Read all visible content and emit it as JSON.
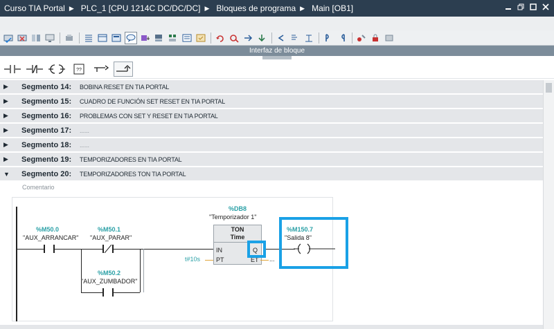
{
  "titlebar": {
    "crumbs": [
      "Curso TIA Portal",
      "PLC_1 [CPU 1214C DC/DC/DC]",
      "Bloques de programa",
      "Main [OB1]"
    ],
    "window_buttons": [
      "minimize",
      "restore",
      "maximize",
      "close"
    ]
  },
  "toolbar": {
    "icons": [
      "insert-network-icon",
      "delete-network-icon",
      "compare-icon",
      "monitor-icon",
      "settings-icon",
      "list-icon",
      "display-icon",
      "note-icon",
      "comment-icon",
      "absolute-icon",
      "symbolic-icon",
      "bookmark-icon",
      "favorites-icon",
      "network-insert-icon",
      "undo-icon",
      "redo-icon",
      "go-to-icon",
      "back-icon",
      "forward-icon",
      "monitor-on-icon",
      "monitor-off-icon",
      "download-icon",
      "online-icon"
    ]
  },
  "interface_bar": {
    "label": "Interfaz de bloque"
  },
  "ladder_toolbar": {
    "items": [
      "normally-open-contact-icon",
      "normally-closed-contact-icon",
      "coil-icon",
      "empty-box-icon",
      "open-branch-icon",
      "close-branch-icon"
    ],
    "empty_box_label": "??"
  },
  "segments": [
    {
      "name": "Segmento 14:",
      "desc": "BOBINA RESET EN TIA PORTAL",
      "expanded": false
    },
    {
      "name": "Segmento 15:",
      "desc": "CUADRO DE FUNCIÓN SET RESET EN TIA PORTAL",
      "expanded": false
    },
    {
      "name": "Segmento 16:",
      "desc": "PROBLEMAS CON SET Y RESET EN TIA PORTAL",
      "expanded": false
    },
    {
      "name": "Segmento 17:",
      "desc": "......",
      "expanded": false
    },
    {
      "name": "Segmento 18:",
      "desc": "......",
      "expanded": false
    },
    {
      "name": "Segmento 19:",
      "desc": "TEMPORIZADORES EN TIA PORTAL",
      "expanded": false
    },
    {
      "name": "Segmento 20:",
      "desc": "TEMPORIZADORES TON TIA PORTAL",
      "expanded": true
    }
  ],
  "network": {
    "comment": "Comentario",
    "contact1": {
      "addr": "%M50.0",
      "symbol": "\"AUX_ARRANCAR\""
    },
    "contact2": {
      "addr": "%M50.1",
      "symbol": "\"AUX_PARAR\""
    },
    "contact3": {
      "addr": "%M50.2",
      "symbol": "\"AUX_ZUMBADOR\""
    },
    "timer": {
      "db": "%DB8",
      "instance": "\"Temporizador 1\"",
      "type": "TON",
      "subtype": "Time",
      "pin_in": "IN",
      "pin_pt": "PT",
      "pin_q": "Q",
      "pin_et": "ET",
      "pt_value": "t#10s",
      "et_value": "..."
    },
    "coil": {
      "addr": "%M150.7",
      "symbol": "\"Salida 8\""
    }
  },
  "colors": {
    "titlebar": "#2c3e50",
    "highlight": "#1aa1e6",
    "address": "#2aa0a6",
    "segment_bg": "#e4e6e9"
  }
}
